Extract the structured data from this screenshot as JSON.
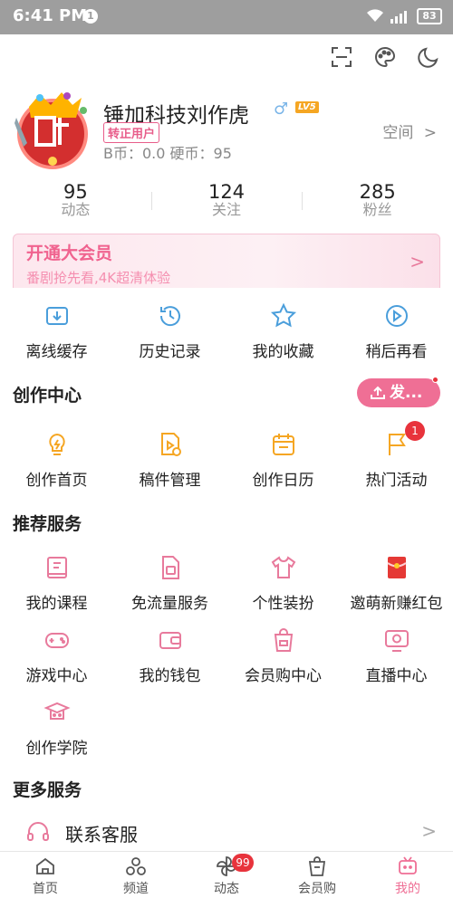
{
  "status": {
    "time": "6:41 PM",
    "notif": "1",
    "battery": "83"
  },
  "profile": {
    "name": "锤加科技刘作虎",
    "gender": "♂",
    "level": "LV5",
    "badge": "转正用户",
    "coins": "B币：0.0   硬币：95",
    "space_label": "空间",
    "space_chevron": ">"
  },
  "stats": [
    {
      "num": "95",
      "label": "动态"
    },
    {
      "num": "124",
      "label": "关注"
    },
    {
      "num": "285",
      "label": "粉丝"
    }
  ],
  "vip": {
    "title": "开通大会员",
    "subtitle": "番剧抢先看,4K超清体验",
    "chevron": ">"
  },
  "quick": [
    {
      "label": "离线缓存",
      "icon": "download-icon"
    },
    {
      "label": "历史记录",
      "icon": "history-icon"
    },
    {
      "label": "我的收藏",
      "icon": "star-icon"
    },
    {
      "label": "稍后再看",
      "icon": "watch-later-icon"
    }
  ],
  "creator": {
    "title": "创作中心",
    "post_button": "发...",
    "items": [
      {
        "label": "创作首页",
        "icon": "bulb-icon"
      },
      {
        "label": "稿件管理",
        "icon": "manuscript-icon"
      },
      {
        "label": "创作日历",
        "icon": "calendar-icon"
      },
      {
        "label": "热门活动",
        "icon": "flag-icon",
        "badge": "1"
      }
    ]
  },
  "recommend": {
    "title": "推荐服务",
    "row1": [
      {
        "label": "我的课程",
        "icon": "course-icon"
      },
      {
        "label": "免流量服务",
        "icon": "sim-icon"
      },
      {
        "label": "个性装扮",
        "icon": "tshirt-icon"
      },
      {
        "label": "邀萌新赚红包",
        "icon": "redpacket-icon"
      }
    ],
    "row2": [
      {
        "label": "游戏中心",
        "icon": "gamepad-icon"
      },
      {
        "label": "我的钱包",
        "icon": "wallet-icon"
      },
      {
        "label": "会员购中心",
        "icon": "shopping-bag-icon"
      },
      {
        "label": "直播中心",
        "icon": "live-tv-icon"
      }
    ],
    "row3": [
      {
        "label": "创作学院",
        "icon": "academy-icon"
      }
    ]
  },
  "more": {
    "title": "更多服务",
    "support": "联系客服",
    "chevron": ">"
  },
  "nav": [
    {
      "label": "首页",
      "icon": "home-icon"
    },
    {
      "label": "频道",
      "icon": "channel-icon"
    },
    {
      "label": "动态",
      "icon": "dynamic-icon",
      "badge": "99"
    },
    {
      "label": "会员购",
      "icon": "shop-icon"
    },
    {
      "label": "我的",
      "icon": "mine-icon",
      "active": true
    }
  ],
  "colors": {
    "accent": "#ef6f95",
    "blue_icon": "#4a9edb",
    "orange_icon": "#f5a623",
    "pink_icon": "#e87a9c"
  }
}
